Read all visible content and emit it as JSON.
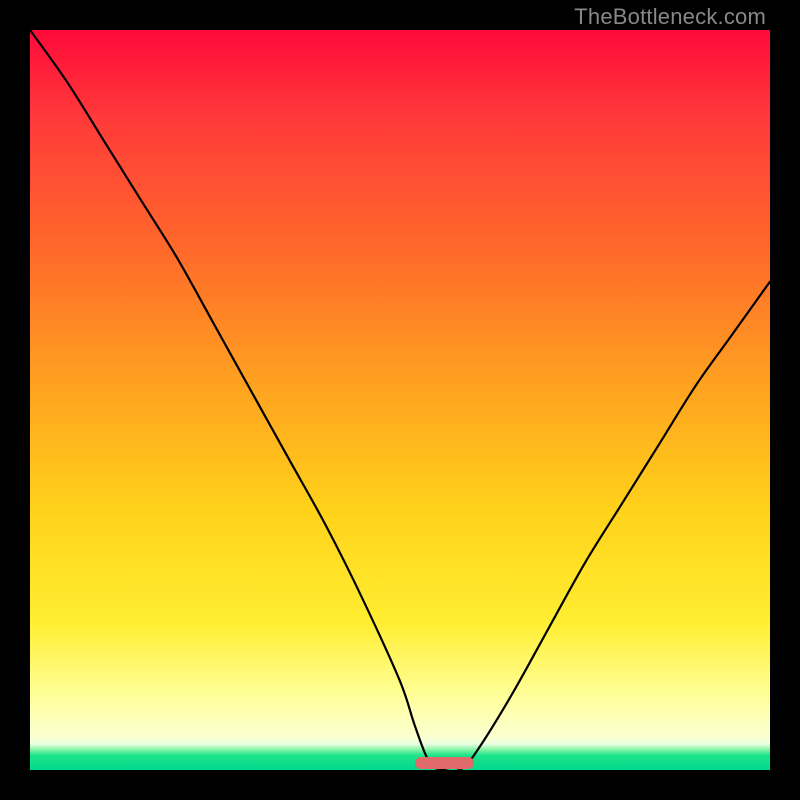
{
  "watermark": "TheBottleneck.com",
  "colors": {
    "frame": "#000000",
    "gradient_top": "#ff0a3a",
    "gradient_mid": "#ffd21a",
    "gradient_bottom": "#00d98c",
    "curve": "#000000",
    "marker": "#e06a6a"
  },
  "chart_data": {
    "type": "line",
    "title": "",
    "xlabel": "",
    "ylabel": "",
    "xlim": [
      0,
      100
    ],
    "ylim": [
      0,
      100
    ],
    "x": [
      0,
      5,
      10,
      15,
      20,
      25,
      30,
      35,
      40,
      45,
      50,
      52,
      54,
      56,
      58,
      60,
      65,
      70,
      75,
      80,
      85,
      90,
      95,
      100
    ],
    "series": [
      {
        "name": "bottleneck-curve",
        "values": [
          100,
          93,
          85,
          77,
          69,
          60,
          51,
          42,
          33,
          23,
          12,
          6,
          1,
          0,
          0,
          2,
          10,
          19,
          28,
          36,
          44,
          52,
          59,
          66
        ]
      }
    ],
    "marker": {
      "x_start": 52,
      "x_end": 60,
      "value": 0
    },
    "annotations": []
  }
}
